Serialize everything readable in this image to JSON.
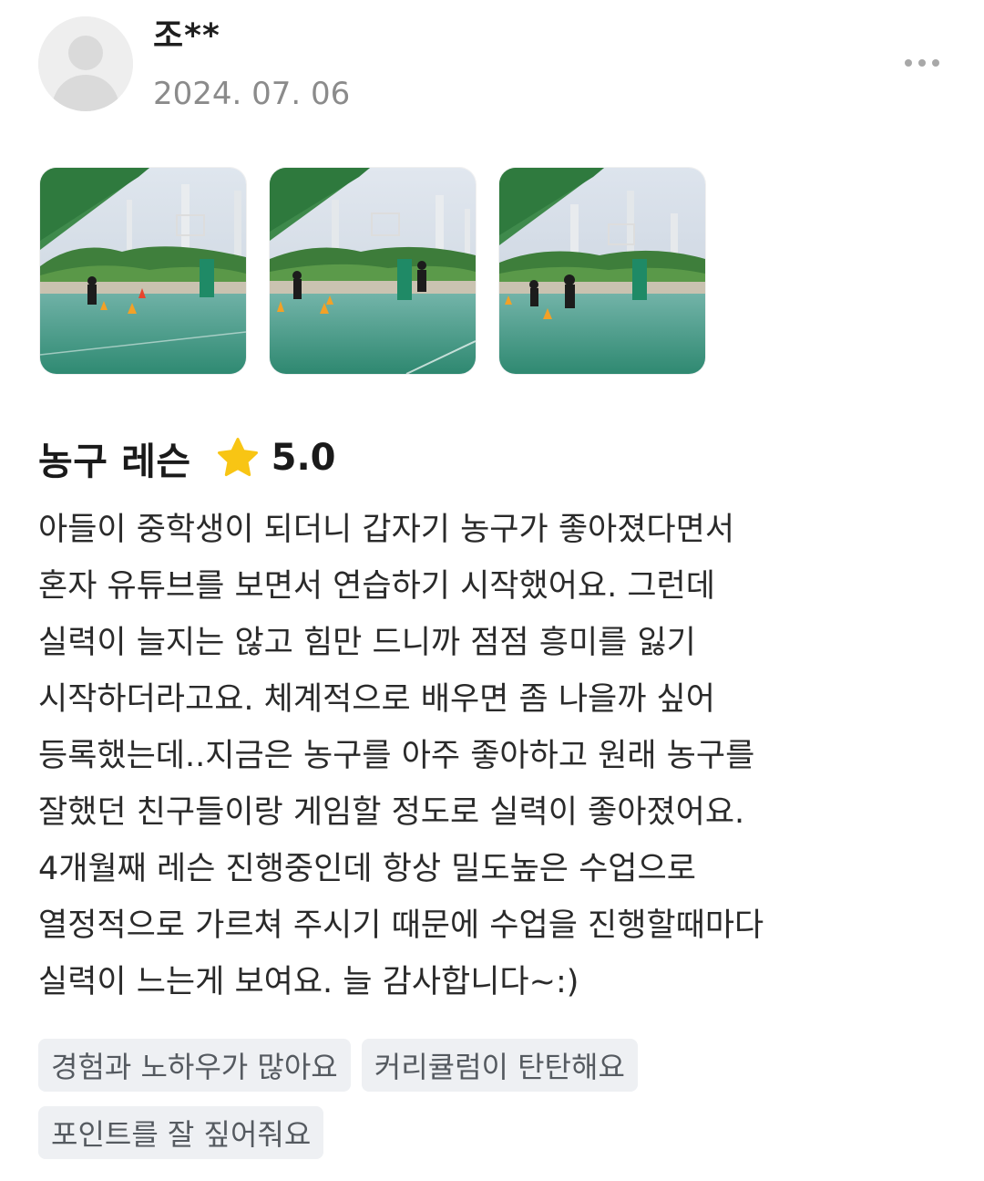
{
  "review": {
    "username": "조**",
    "date": "2024. 07. 06",
    "service_name": "농구 레슨",
    "rating": "5.0",
    "rating_value": 5.0,
    "rating_max": 5,
    "text_lines": [
      "아들이 중학생이 되더니 갑자기 농구가 좋아졌다면서",
      "혼자 유튜브를 보면서 연습하기 시작했어요. 그런데",
      "실력이 늘지는 않고 힘만 드니까  점점 흥미를 잃기",
      "시작하더라고요. 체계적으로 배우면 좀 나을까 싶어",
      "등록했는데..지금은 농구를 아주 좋아하고 원래 농구를",
      "잘했던 친구들이랑 게임할 정도로 실력이 좋아졌어요.",
      "4개월째 레슨 진행중인데 항상 밀도높은 수업으로",
      "열정적으로 가르쳐 주시기 때문에 수업을 진행할때마다",
      "실력이 느는게 보여요. 늘 감사합니다~:)"
    ],
    "tags": [
      [
        "경험과 노하우가 많아요",
        "커리큘럼이 탄탄해요"
      ],
      [
        "포인트를 잘 짚어줘요"
      ]
    ],
    "photo_count": 3,
    "icons": {
      "avatar": "default-user-avatar-icon",
      "more": "more-options-icon",
      "star": "star-icon"
    },
    "colors": {
      "star": "#f8c514",
      "tag_background": "#eef0f3",
      "date_text": "#8b8b8b"
    }
  }
}
